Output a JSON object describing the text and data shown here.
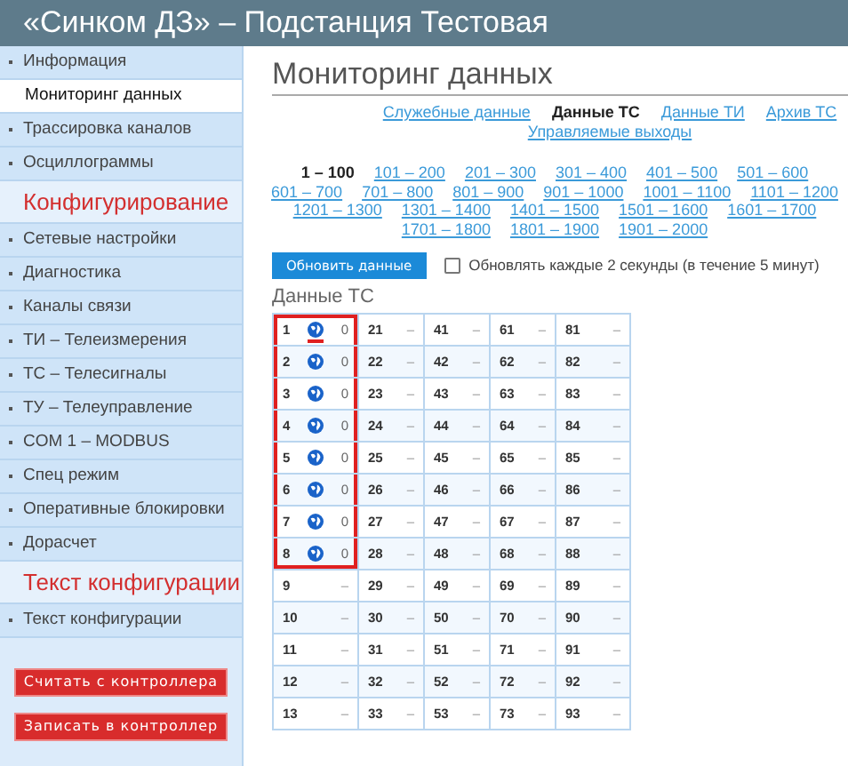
{
  "header": {
    "title": "«Синком ДЗ» – Подстанция Тестовая"
  },
  "sidebar": {
    "items": [
      {
        "kind": "item",
        "label": "Информация",
        "selected": false
      },
      {
        "kind": "item",
        "label": "Мониторинг данных",
        "selected": true
      },
      {
        "kind": "item",
        "label": "Трассировка каналов",
        "selected": false
      },
      {
        "kind": "item",
        "label": "Осциллограммы",
        "selected": false
      },
      {
        "kind": "section",
        "label": "Конфигурирование",
        "selected": false
      },
      {
        "kind": "item",
        "label": "Сетевые настройки",
        "selected": false
      },
      {
        "kind": "item",
        "label": "Диагностика",
        "selected": false
      },
      {
        "kind": "item",
        "label": "Каналы связи",
        "selected": false
      },
      {
        "kind": "item",
        "label": "ТИ – Телеизмерения",
        "selected": false
      },
      {
        "kind": "item",
        "label": "ТС – Телесигналы",
        "selected": false
      },
      {
        "kind": "item",
        "label": "ТУ – Телеуправление",
        "selected": false
      },
      {
        "kind": "item",
        "label": "COM 1 – MODBUS",
        "selected": false
      },
      {
        "kind": "item",
        "label": "Спец режим",
        "selected": false
      },
      {
        "kind": "item",
        "label": "Оперативные блокировки",
        "selected": false
      },
      {
        "kind": "item",
        "label": "Дорасчет",
        "selected": false
      },
      {
        "kind": "section",
        "label": "Текст конфигурации",
        "selected": false
      },
      {
        "kind": "item",
        "label": "Текст конфигурации",
        "selected": false
      }
    ],
    "buttons": [
      "Считать с контроллера",
      "Записать в контроллер"
    ]
  },
  "page_title": "Мониторинг данных",
  "tabs": [
    {
      "label": "Служебные данные",
      "selected": false
    },
    {
      "label": "Данные ТС",
      "selected": true
    },
    {
      "label": "Данные ТИ",
      "selected": false
    },
    {
      "label": "Архив ТС",
      "selected": false
    },
    {
      "label": "Управляемые выходы",
      "selected": false
    }
  ],
  "ranges": [
    {
      "label": "1 – 100",
      "selected": true
    },
    {
      "label": "101 – 200",
      "selected": false
    },
    {
      "label": "201 – 300",
      "selected": false
    },
    {
      "label": "301 – 400",
      "selected": false
    },
    {
      "label": "401 – 500",
      "selected": false
    },
    {
      "label": "501 – 600",
      "selected": false
    },
    {
      "label": "601 – 700",
      "selected": false
    },
    {
      "label": "701 – 800",
      "selected": false
    },
    {
      "label": "801 – 900",
      "selected": false
    },
    {
      "label": "901 – 1000",
      "selected": false
    },
    {
      "label": "1001 – 1100",
      "selected": false
    },
    {
      "label": "1101 – 1200",
      "selected": false
    },
    {
      "label": "1201 – 1300",
      "selected": false
    },
    {
      "label": "1301 – 1400",
      "selected": false
    },
    {
      "label": "1401 – 1500",
      "selected": false
    },
    {
      "label": "1501 – 1600",
      "selected": false
    },
    {
      "label": "1601 – 1700",
      "selected": false
    },
    {
      "label": "1701 – 1800",
      "selected": false
    },
    {
      "label": "1801 – 1900",
      "selected": false
    },
    {
      "label": "1901 – 2000",
      "selected": false
    }
  ],
  "refresh_button": "Обновить данные",
  "auto_refresh": {
    "label": "Обновлять каждые 2 секунды (в течение 5 минут)",
    "checked": false
  },
  "table": {
    "title": "Данные ТС",
    "rows": [
      [
        {
          "number": "1",
          "value": "0",
          "icon": true,
          "highlighted": true,
          "underlined": true
        },
        {
          "number": "21",
          "value": "–",
          "icon": false,
          "highlighted": false,
          "underlined": false
        },
        {
          "number": "41",
          "value": "–",
          "icon": false,
          "highlighted": false,
          "underlined": false
        },
        {
          "number": "61",
          "value": "–",
          "icon": false,
          "highlighted": false,
          "underlined": false
        },
        {
          "number": "81",
          "value": "–",
          "icon": false,
          "highlighted": false,
          "underlined": false
        }
      ],
      [
        {
          "number": "2",
          "value": "0",
          "icon": true,
          "highlighted": true,
          "underlined": false
        },
        {
          "number": "22",
          "value": "–",
          "icon": false,
          "highlighted": false,
          "underlined": false
        },
        {
          "number": "42",
          "value": "–",
          "icon": false,
          "highlighted": false,
          "underlined": false
        },
        {
          "number": "62",
          "value": "–",
          "icon": false,
          "highlighted": false,
          "underlined": false
        },
        {
          "number": "82",
          "value": "–",
          "icon": false,
          "highlighted": false,
          "underlined": false
        }
      ],
      [
        {
          "number": "3",
          "value": "0",
          "icon": true,
          "highlighted": true,
          "underlined": false
        },
        {
          "number": "23",
          "value": "–",
          "icon": false,
          "highlighted": false,
          "underlined": false
        },
        {
          "number": "43",
          "value": "–",
          "icon": false,
          "highlighted": false,
          "underlined": false
        },
        {
          "number": "63",
          "value": "–",
          "icon": false,
          "highlighted": false,
          "underlined": false
        },
        {
          "number": "83",
          "value": "–",
          "icon": false,
          "highlighted": false,
          "underlined": false
        }
      ],
      [
        {
          "number": "4",
          "value": "0",
          "icon": true,
          "highlighted": true,
          "underlined": false
        },
        {
          "number": "24",
          "value": "–",
          "icon": false,
          "highlighted": false,
          "underlined": false
        },
        {
          "number": "44",
          "value": "–",
          "icon": false,
          "highlighted": false,
          "underlined": false
        },
        {
          "number": "64",
          "value": "–",
          "icon": false,
          "highlighted": false,
          "underlined": false
        },
        {
          "number": "84",
          "value": "–",
          "icon": false,
          "highlighted": false,
          "underlined": false
        }
      ],
      [
        {
          "number": "5",
          "value": "0",
          "icon": true,
          "highlighted": true,
          "underlined": false
        },
        {
          "number": "25",
          "value": "–",
          "icon": false,
          "highlighted": false,
          "underlined": false
        },
        {
          "number": "45",
          "value": "–",
          "icon": false,
          "highlighted": false,
          "underlined": false
        },
        {
          "number": "65",
          "value": "–",
          "icon": false,
          "highlighted": false,
          "underlined": false
        },
        {
          "number": "85",
          "value": "–",
          "icon": false,
          "highlighted": false,
          "underlined": false
        }
      ],
      [
        {
          "number": "6",
          "value": "0",
          "icon": true,
          "highlighted": true,
          "underlined": false
        },
        {
          "number": "26",
          "value": "–",
          "icon": false,
          "highlighted": false,
          "underlined": false
        },
        {
          "number": "46",
          "value": "–",
          "icon": false,
          "highlighted": false,
          "underlined": false
        },
        {
          "number": "66",
          "value": "–",
          "icon": false,
          "highlighted": false,
          "underlined": false
        },
        {
          "number": "86",
          "value": "–",
          "icon": false,
          "highlighted": false,
          "underlined": false
        }
      ],
      [
        {
          "number": "7",
          "value": "0",
          "icon": true,
          "highlighted": true,
          "underlined": false
        },
        {
          "number": "27",
          "value": "–",
          "icon": false,
          "highlighted": false,
          "underlined": false
        },
        {
          "number": "47",
          "value": "–",
          "icon": false,
          "highlighted": false,
          "underlined": false
        },
        {
          "number": "67",
          "value": "–",
          "icon": false,
          "highlighted": false,
          "underlined": false
        },
        {
          "number": "87",
          "value": "–",
          "icon": false,
          "highlighted": false,
          "underlined": false
        }
      ],
      [
        {
          "number": "8",
          "value": "0",
          "icon": true,
          "highlighted": true,
          "underlined": false
        },
        {
          "number": "28",
          "value": "–",
          "icon": false,
          "highlighted": false,
          "underlined": false
        },
        {
          "number": "48",
          "value": "–",
          "icon": false,
          "highlighted": false,
          "underlined": false
        },
        {
          "number": "68",
          "value": "–",
          "icon": false,
          "highlighted": false,
          "underlined": false
        },
        {
          "number": "88",
          "value": "–",
          "icon": false,
          "highlighted": false,
          "underlined": false
        }
      ],
      [
        {
          "number": "9",
          "value": "–",
          "icon": false,
          "highlighted": false,
          "underlined": false
        },
        {
          "number": "29",
          "value": "–",
          "icon": false,
          "highlighted": false,
          "underlined": false
        },
        {
          "number": "49",
          "value": "–",
          "icon": false,
          "highlighted": false,
          "underlined": false
        },
        {
          "number": "69",
          "value": "–",
          "icon": false,
          "highlighted": false,
          "underlined": false
        },
        {
          "number": "89",
          "value": "–",
          "icon": false,
          "highlighted": false,
          "underlined": false
        }
      ],
      [
        {
          "number": "10",
          "value": "–",
          "icon": false,
          "highlighted": false,
          "underlined": false
        },
        {
          "number": "30",
          "value": "–",
          "icon": false,
          "highlighted": false,
          "underlined": false
        },
        {
          "number": "50",
          "value": "–",
          "icon": false,
          "highlighted": false,
          "underlined": false
        },
        {
          "number": "70",
          "value": "–",
          "icon": false,
          "highlighted": false,
          "underlined": false
        },
        {
          "number": "90",
          "value": "–",
          "icon": false,
          "highlighted": false,
          "underlined": false
        }
      ],
      [
        {
          "number": "11",
          "value": "–",
          "icon": false,
          "highlighted": false,
          "underlined": false
        },
        {
          "number": "31",
          "value": "–",
          "icon": false,
          "highlighted": false,
          "underlined": false
        },
        {
          "number": "51",
          "value": "–",
          "icon": false,
          "highlighted": false,
          "underlined": false
        },
        {
          "number": "71",
          "value": "–",
          "icon": false,
          "highlighted": false,
          "underlined": false
        },
        {
          "number": "91",
          "value": "–",
          "icon": false,
          "highlighted": false,
          "underlined": false
        }
      ],
      [
        {
          "number": "12",
          "value": "–",
          "icon": false,
          "highlighted": false,
          "underlined": false
        },
        {
          "number": "32",
          "value": "–",
          "icon": false,
          "highlighted": false,
          "underlined": false
        },
        {
          "number": "52",
          "value": "–",
          "icon": false,
          "highlighted": false,
          "underlined": false
        },
        {
          "number": "72",
          "value": "–",
          "icon": false,
          "highlighted": false,
          "underlined": false
        },
        {
          "number": "92",
          "value": "–",
          "icon": false,
          "highlighted": false,
          "underlined": false
        }
      ],
      [
        {
          "number": "13",
          "value": "–",
          "icon": false,
          "highlighted": false,
          "underlined": false
        },
        {
          "number": "33",
          "value": "–",
          "icon": false,
          "highlighted": false,
          "underlined": false
        },
        {
          "number": "53",
          "value": "–",
          "icon": false,
          "highlighted": false,
          "underlined": false
        },
        {
          "number": "73",
          "value": "–",
          "icon": false,
          "highlighted": false,
          "underlined": false
        },
        {
          "number": "93",
          "value": "–",
          "icon": false,
          "highlighted": false,
          "underlined": false
        }
      ]
    ]
  }
}
